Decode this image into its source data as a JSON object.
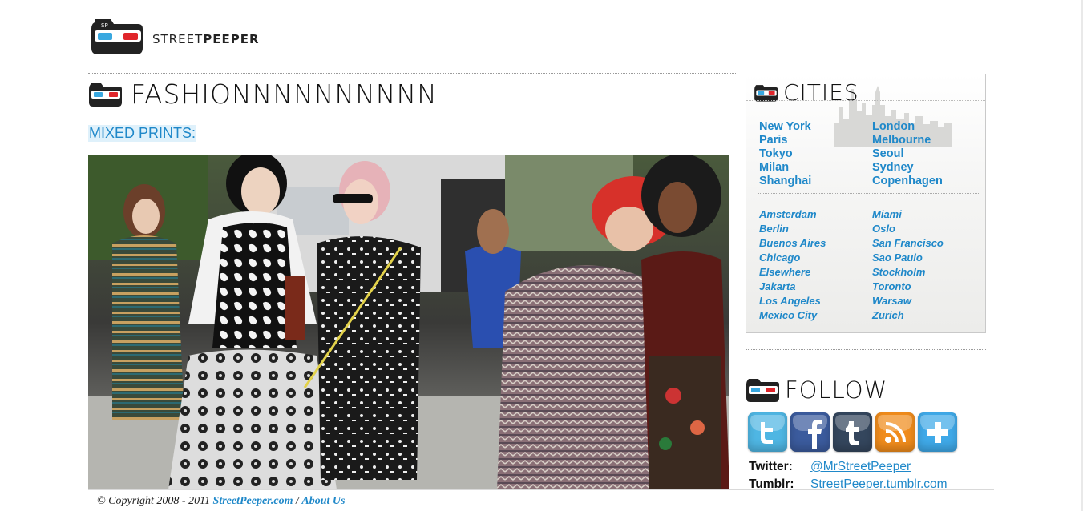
{
  "brand": {
    "name_light": "STREET",
    "name_bold": "PEEPER",
    "badge": "SP"
  },
  "main": {
    "heading": "FASHIONNNNNNNNNN",
    "post_link": "MIXED PRINTS:"
  },
  "cities": {
    "heading": "CITIES",
    "major": [
      "New York",
      "London",
      "Paris",
      "Melbourne",
      "Tokyo",
      "Seoul",
      "Milan",
      "Sydney",
      "Shanghai",
      "Copenhagen"
    ],
    "minor": [
      "Amsterdam",
      "Miami",
      "Berlin",
      "Oslo",
      "Buenos Aires",
      "San Francisco",
      "Chicago",
      "Sao Paulo",
      "Elsewhere",
      "Stockholm",
      "Jakarta",
      "Toronto",
      "Los Angeles",
      "Warsaw",
      "Mexico City",
      "Zurich"
    ]
  },
  "follow": {
    "heading": "FOLLOW",
    "icons": [
      "twitter-icon",
      "facebook-icon",
      "tumblr-icon",
      "rss-icon",
      "plus-icon"
    ],
    "rows": [
      {
        "label": "Twitter:",
        "value": "@MrStreetPeeper"
      },
      {
        "label": "Tumblr:",
        "value": "StreetPeeper.tumblr.com"
      }
    ]
  },
  "footer": {
    "copyright": "© Copyright 2008 - 2011",
    "site_link": "StreetPeeper.com",
    "separator": "/",
    "about_link": "About Us"
  },
  "colors": {
    "link": "#1f88c9",
    "text": "#111111",
    "twitter": "#4fb6e3",
    "facebook": "#3b5b9d",
    "tumblr": "#34465d",
    "rss": "#f08c1c",
    "plus": "#3fa9e8"
  }
}
